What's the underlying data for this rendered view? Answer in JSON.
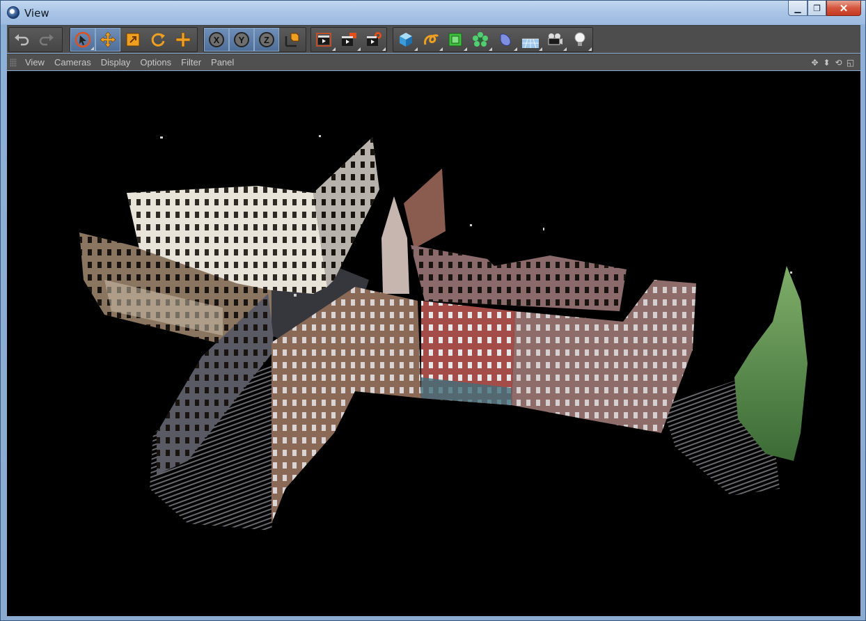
{
  "window": {
    "title": "View",
    "minimize_icon": "minimize-icon",
    "maximize_icon": "maximize-icon",
    "close_icon": "close-icon"
  },
  "toolbar": {
    "groups": [
      {
        "name": "history",
        "items": [
          {
            "icon": "undo-icon"
          },
          {
            "icon": "redo-icon"
          }
        ]
      },
      {
        "name": "tools",
        "items": [
          {
            "icon": "live-selection-icon",
            "active": true
          },
          {
            "icon": "move-icon",
            "active": true
          },
          {
            "icon": "scale-icon"
          },
          {
            "icon": "rotate-icon"
          },
          {
            "icon": "recent-tool-icon"
          }
        ]
      },
      {
        "name": "axes",
        "items": [
          {
            "icon": "x-axis-icon",
            "label": "X"
          },
          {
            "icon": "y-axis-icon",
            "label": "Y"
          },
          {
            "icon": "z-axis-icon",
            "label": "Z"
          },
          {
            "icon": "coordinate-system-icon"
          }
        ]
      },
      {
        "name": "render",
        "items": [
          {
            "icon": "render-view-icon"
          },
          {
            "icon": "render-picture-viewer-icon"
          },
          {
            "icon": "render-settings-icon"
          }
        ]
      },
      {
        "name": "objects",
        "items": [
          {
            "icon": "cube-icon"
          },
          {
            "icon": "spline-icon"
          },
          {
            "icon": "subdivision-icon"
          },
          {
            "icon": "mograph-cloner-icon"
          },
          {
            "icon": "deformer-icon"
          },
          {
            "icon": "floor-icon"
          },
          {
            "icon": "camera-icon"
          },
          {
            "icon": "light-icon"
          }
        ]
      }
    ]
  },
  "menubar": {
    "items": [
      "View",
      "Cameras",
      "Display",
      "Options",
      "Filter",
      "Panel"
    ],
    "nav_icons": [
      "move-view-icon",
      "zoom-view-icon",
      "rotate-view-icon",
      "toggle-layout-icon"
    ]
  },
  "viewport": {
    "content": "point-cloud-scan",
    "background": "#000000"
  },
  "colors": {
    "accent_orange": "#f0a020",
    "toolbar_bg": "#4d4d4d",
    "menubar_bg": "#505050",
    "menu_text": "#c8c8c8"
  }
}
